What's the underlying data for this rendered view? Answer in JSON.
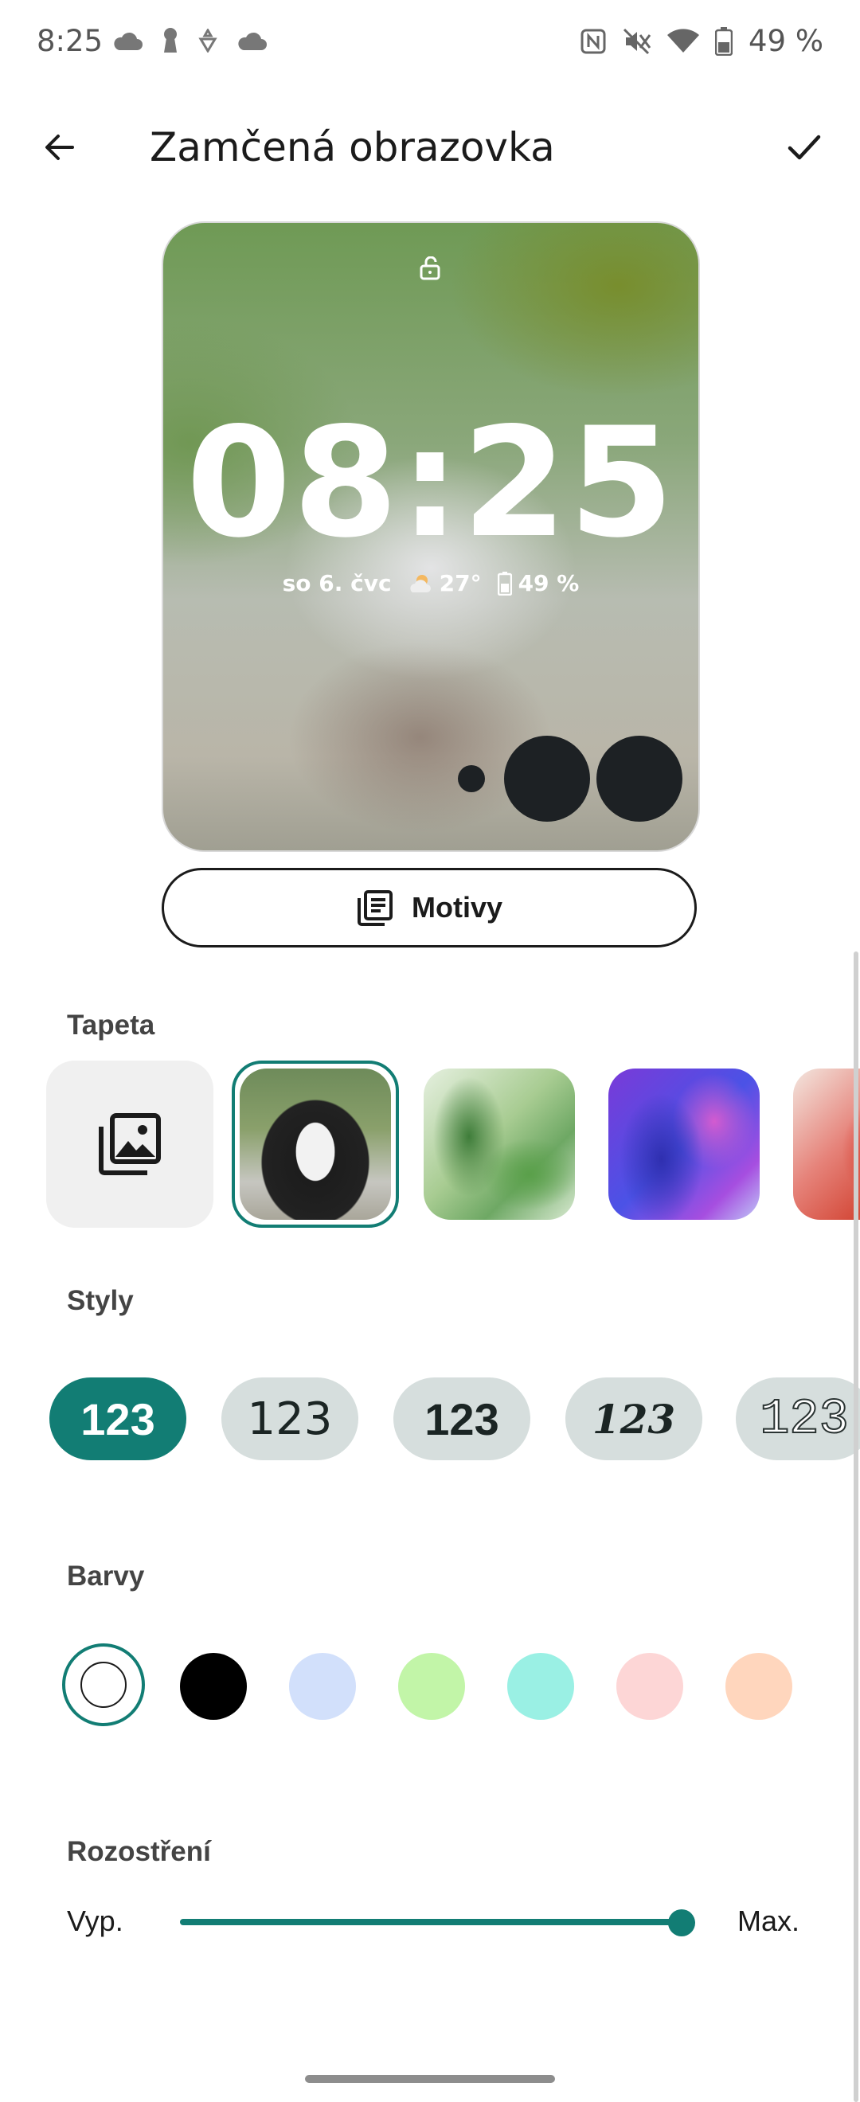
{
  "status_bar": {
    "time": "8:25",
    "battery": "49 %",
    "left_icons": [
      "cloud-icon",
      "keyhole-icon",
      "app-notification-icon",
      "cloud-icon"
    ],
    "right_icons": [
      "nfc-icon",
      "mute-icon",
      "wifi-icon",
      "battery-icon"
    ]
  },
  "header": {
    "title": "Zamčená obrazovka",
    "back_icon": "arrow-back-icon",
    "confirm_icon": "check-icon"
  },
  "preview": {
    "clock": "08:25",
    "date": "so 6. čvc",
    "temperature": "27°",
    "battery": "49 %"
  },
  "themes_button": {
    "label": "Motivy",
    "icon": "library-icon"
  },
  "wallpaper": {
    "title": "Tapeta",
    "items": [
      "add-from-gallery",
      "husky-dog",
      "green-silk",
      "purple-silk",
      "red-silk"
    ],
    "selected_index": 1
  },
  "styles": {
    "title": "Styly",
    "items": [
      "123",
      "123",
      "123",
      "123",
      "123"
    ],
    "selected_index": 0
  },
  "colors": {
    "title": "Barvy",
    "swatches": [
      "#ffffff",
      "#000000",
      "#d2e0fb",
      "#c2f5a8",
      "#9af0e4",
      "#fdd6d6",
      "#ffd6bd"
    ],
    "selected_index": 0,
    "accent": "#127d74"
  },
  "blur": {
    "title": "Rozostření",
    "min_label": "Vyp.",
    "max_label": "Max.",
    "value": 1.0
  }
}
